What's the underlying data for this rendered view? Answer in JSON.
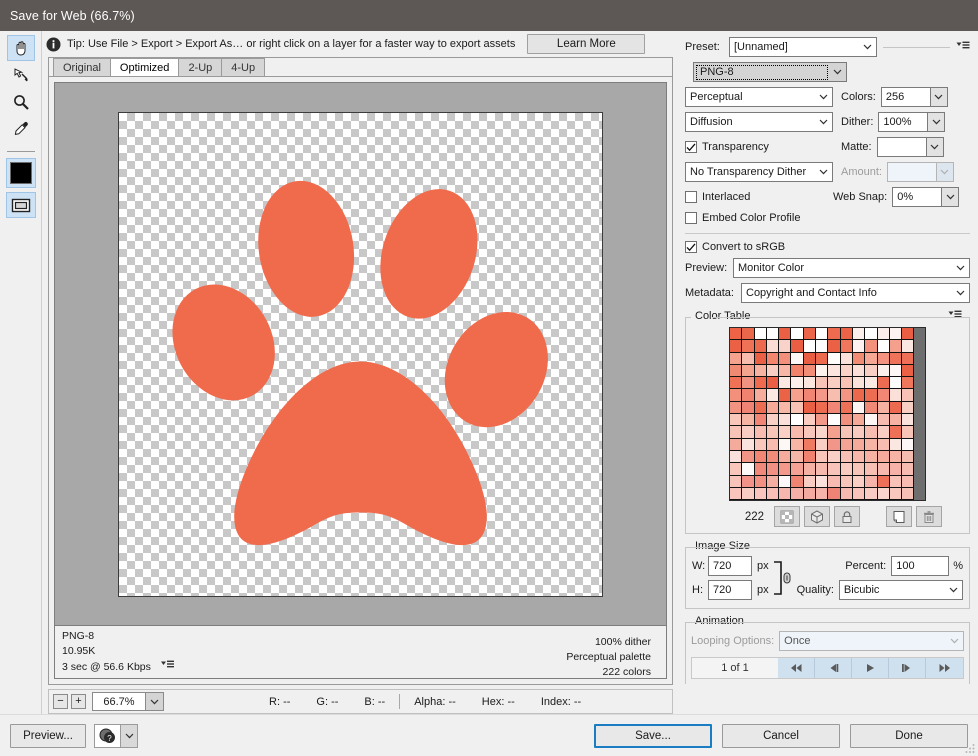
{
  "window": {
    "title": "Save for Web (66.7%)"
  },
  "toolbar": {
    "tools": [
      {
        "name": "hand-tool",
        "selected": true
      },
      {
        "name": "slice-select-tool",
        "selected": false
      },
      {
        "name": "zoom-tool",
        "selected": false
      },
      {
        "name": "eyedropper-tool",
        "selected": false
      }
    ],
    "foreground_color": "#000000",
    "slice_visibility_label": "Toggle Slices Visibility"
  },
  "tip": {
    "text": "Tip: Use File > Export > Export As…  or right click on a layer for a faster way to export assets",
    "button_label": "Learn More"
  },
  "view_tabs": [
    {
      "label": "Original",
      "active": false
    },
    {
      "label": "Optimized",
      "active": true
    },
    {
      "label": "2-Up",
      "active": false
    },
    {
      "label": "4-Up",
      "active": false
    }
  ],
  "preview": {
    "artwork_color": "#F06A4C",
    "checker_light": "#ffffff",
    "checker_dark": "#c8c8c8"
  },
  "image_info": {
    "format": "PNG-8",
    "file_size": "10.95K",
    "download_time": "3 sec @ 56.6 Kbps",
    "dither": "100% dither",
    "palette": "Perceptual palette",
    "colors": "222 colors"
  },
  "status_bar": {
    "zoom_out_label": "−",
    "zoom_in_label": "+",
    "zoom_level": "66.7%",
    "readouts": [
      {
        "label": "R:",
        "value": "--"
      },
      {
        "label": "G:",
        "value": "--"
      },
      {
        "label": "B:",
        "value": "--"
      }
    ],
    "readouts2": [
      {
        "label": "Alpha:",
        "value": "--"
      },
      {
        "label": "Hex:",
        "value": "--"
      },
      {
        "label": "Index:",
        "value": "--"
      }
    ]
  },
  "settings": {
    "preset_label": "Preset:",
    "preset_value": "[Unnamed]",
    "format_value": "PNG-8",
    "reduction_value": "Perceptual",
    "colors_label": "Colors:",
    "colors_value": "256",
    "dither_algo_value": "Diffusion",
    "dither_label": "Dither:",
    "dither_value": "100%",
    "transparency_label": "Transparency",
    "transparency_checked": true,
    "matte_label": "Matte:",
    "matte_value": "",
    "transparency_dither_value": "No Transparency Dither",
    "amount_label": "Amount:",
    "amount_value": "",
    "interlaced_label": "Interlaced",
    "interlaced_checked": false,
    "web_snap_label": "Web Snap:",
    "web_snap_value": "0%",
    "embed_color_profile_label": "Embed Color Profile",
    "embed_color_profile_checked": false,
    "convert_srgb_label": "Convert to sRGB",
    "convert_srgb_checked": true,
    "preview_label": "Preview:",
    "preview_value": "Monitor Color",
    "metadata_label": "Metadata:",
    "metadata_value": "Copyright and Contact Info"
  },
  "color_table": {
    "legend": "Color Table",
    "count": "222",
    "columns": 16,
    "buttons": [
      {
        "name": "map-to-transparent-button"
      },
      {
        "name": "map-to-web-palette-button"
      },
      {
        "name": "lock-color-button"
      },
      {
        "name": "new-color-button"
      },
      {
        "name": "delete-color-button"
      }
    ],
    "swatches": [
      "#ee6246",
      "#eb674c",
      "#ffffff",
      "#fdfdfd",
      "#ea6044",
      "#ffffff",
      "#ec644a",
      "#fefefe",
      "#ee6b50",
      "#ec6348",
      "#fcf0ed",
      "#ffffff",
      "#fbeeea",
      "#fdf4f1",
      "#ea5f43",
      "#eb6145",
      "#ef7257",
      "#ed6a4e",
      "#fbdcd5",
      "#f9d3ca",
      "#ea5f43",
      "#ffffff",
      "#fefdfd",
      "#ea6145",
      "#f0765c",
      "#fdf2ef",
      "#f3917c",
      "#fefefe",
      "#f5a08d",
      "#fbe7e1",
      "#f5a38f",
      "#f7bcae",
      "#ea6044",
      "#f2866e",
      "#f3907b",
      "#fdf8f6",
      "#e95e42",
      "#ed6a4e",
      "#fefdfc",
      "#fae2db",
      "#f08b74",
      "#f6a894",
      "#f39380",
      "#ef7358",
      "#ef7056",
      "#f08a73",
      "#f5a48f",
      "#f7b3a2",
      "#f9cec3",
      "#f7b6a6",
      "#f2836b",
      "#f28e77",
      "#fcf2ee",
      "#fbe5de",
      "#f9d2c8",
      "#fae0d8",
      "#f9cfc4",
      "#fcf0ec",
      "#fdf7f5",
      "#ea6145",
      "#ef7257",
      "#f29280",
      "#ee6b50",
      "#eb6044",
      "#fbe8e2",
      "#fcf1ed",
      "#fbe6e0",
      "#f8c4b7",
      "#f9cec3",
      "#f8c2b4",
      "#fae3db",
      "#fbe9e3",
      "#ee6c51",
      "#fefdfd",
      "#f0775c",
      "#f3907b",
      "#f18270",
      "#f6ae9c",
      "#fbe9e3",
      "#eb6347",
      "#f5a18e",
      "#f18473",
      "#f4988a",
      "#f7beb0",
      "#f29582",
      "#ec684c",
      "#ed6d52",
      "#f18774",
      "#fae0d9",
      "#f8c3b6",
      "#f29280",
      "#f08373",
      "#ed6d52",
      "#f6ab99",
      "#f7b8a8",
      "#f8c2b5",
      "#ea6044",
      "#ed6b4f",
      "#f08776",
      "#ee7056",
      "#fdf5f2",
      "#f08a77",
      "#f6b1a0",
      "#ec6b50",
      "#f9cec3",
      "#f8c7ba",
      "#f6b5a4",
      "#f18576",
      "#f9d0c6",
      "#fae0da",
      "#ffffff",
      "#f9cdc2",
      "#f3998a",
      "#fefdfc",
      "#f29080",
      "#f5aa99",
      "#fdf6f4",
      "#f7bcaf",
      "#f6b2a2",
      "#fae1db",
      "#f8c3b7",
      "#f9cdc3",
      "#f7bdb0",
      "#f8c5b9",
      "#f9d0c6",
      "#f7bbae",
      "#f8c6ba",
      "#f9d5cb",
      "#f4a190",
      "#f8c4b8",
      "#f9cbc0",
      "#f7bdb1",
      "#f9cdc4",
      "#ee7157",
      "#f8c4b8",
      "#f5ab9b",
      "#fbe4de",
      "#f8c8bc",
      "#f7bcaf",
      "#fdf8f6",
      "#f6b5a5",
      "#ef7a62",
      "#f9cfc5",
      "#f3968a",
      "#f4a395",
      "#f5ab9c",
      "#f6b4a5",
      "#f7bdb0",
      "#fbe7e2",
      "#fdf8f7",
      "#fae0da",
      "#f39585",
      "#f08673",
      "#f18c7b",
      "#f5ac9d",
      "#f6b6a7",
      "#f18270",
      "#f8c5ba",
      "#f9cec5",
      "#f8c1b6",
      "#f7b8ab",
      "#f6b1a3",
      "#f5aa9c",
      "#f6b4a6",
      "#f7bcb0",
      "#f8c6ba",
      "#fdf9f8",
      "#f0897a",
      "#f29183",
      "#f3998c",
      "#f4a296",
      "#f6b1a5",
      "#f7baae",
      "#f8c3b8",
      "#f9ccc1",
      "#f8c5bb",
      "#f8c0b5",
      "#f7b9af",
      "#f6b2a8",
      "#f7bbb1",
      "#f8c4ba",
      "#f29289",
      "#f19184",
      "#f5aea2",
      "#fdf8f7",
      "#ef8472",
      "#f9cdc4",
      "#fae1db",
      "#f7bbb1",
      "#f8c5bb",
      "#f9cfc6",
      "#f6b3a9",
      "#ee7058",
      "#f8c2b8",
      "#f7bbb1",
      "#f8c4bb",
      "#f9cdc4",
      "#f8c6be",
      "#f7bfb6",
      "#f6b8ae",
      "#f5b1a8",
      "#f4aaa1",
      "#f5b3aa",
      "#ef8476",
      "#f6bab0",
      "#f7c3ba",
      "#f8ccc3",
      "#f9d5cc",
      "#f8c7be",
      "#f7c0b7",
      "#f6b9b0",
      "#f5b2a9",
      "#f6bbb2",
      "#f7c4bb",
      "#f8cdc4",
      "#f9d6cd",
      "#f7c2b9",
      "#f6bbb2",
      "#f5b4ab",
      "#f6bdb4",
      "#f7c6bd",
      "#f8cfc6",
      "#fae3dd",
      "#fdf6f4"
    ],
    "last_row": [
      "#f9d4cb",
      "#f8cdc4",
      "#fbe4de",
      "#f7c1b8",
      "#f9d1c8",
      "#f8cac1",
      "#fae0da",
      "#f6bdb4",
      "#f9d3ca",
      "#f7c6bd",
      "#fbe8e3",
      "#f9d9d1",
      "#fdf3f1"
    ]
  },
  "image_size": {
    "legend": "Image Size",
    "w_label": "W:",
    "w_value": "720",
    "w_unit": "px",
    "h_label": "H:",
    "h_value": "720",
    "h_unit": "px",
    "percent_label": "Percent:",
    "percent_value": "100",
    "percent_unit": "%",
    "quality_label": "Quality:",
    "quality_value": "Bicubic"
  },
  "animation": {
    "legend": "Animation",
    "looping_label": "Looping Options:",
    "looping_value": "Once",
    "frame_count": "1 of 1",
    "controls": [
      {
        "name": "first-frame-button"
      },
      {
        "name": "previous-frame-button"
      },
      {
        "name": "play-button"
      },
      {
        "name": "next-frame-button"
      },
      {
        "name": "last-frame-button"
      }
    ]
  },
  "footer": {
    "preview_label": "Preview...",
    "browser_select_name": "preview-browser-select",
    "save_label": "Save...",
    "cancel_label": "Cancel",
    "done_label": "Done"
  }
}
